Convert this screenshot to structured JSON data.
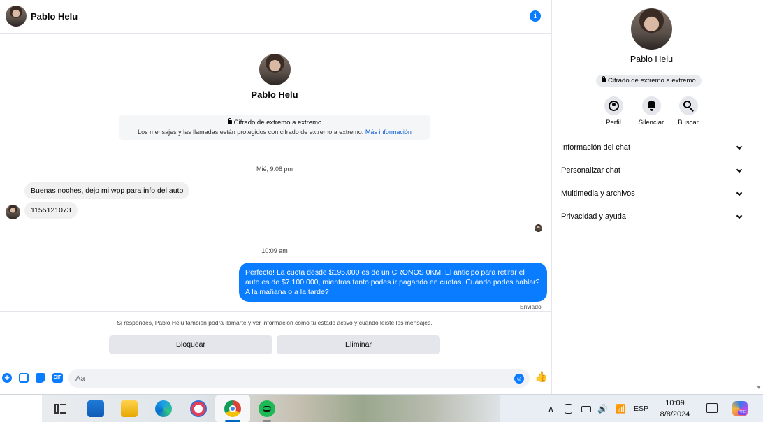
{
  "contact": {
    "name": "Pablo Helu"
  },
  "chat": {
    "encryption_title": "Cifrado de extremo a extremo",
    "encryption_desc": "Los mensajes y las llamadas están protegidos con cifrado de extremo a extremo.",
    "encryption_link": "Más información",
    "timestamps": [
      "Mié, 9:08 pm",
      "10:09 am"
    ],
    "incoming": [
      "Buenas noches, dejo mi wpp para info del auto",
      "1155121073"
    ],
    "outgoing": "Perfecto! La cuota desde $195.000 es de un CRONOS 0KM. El anticipo para retirar el auto es de $7.100.000, mientras tanto podes ir pagando en cuotas. Cuándo podes hablar? A la mañana o a la tarde?",
    "sent_status": "Enviado",
    "notice": "Si respondes, Pablo Helu también podrá llamarte y ver información como tu estado activo y cuándo leíste los mensajes.",
    "block_label": "Bloquear",
    "delete_label": "Eliminar",
    "input_placeholder": "Aa",
    "gif_label": "GIF"
  },
  "panel": {
    "badge": "Cifrado de extremo a extremo",
    "actions": [
      "Perfil",
      "Silenciar",
      "Buscar"
    ],
    "sections": [
      "Información del chat",
      "Personalizar chat",
      "Multimedia y archivos",
      "Privacidad y ayuda"
    ]
  },
  "taskbar": {
    "language": "ESP",
    "time": "10:09",
    "date": "8/8/2024"
  },
  "colors": {
    "accent": "#0a7cff",
    "bubble_in": "#f0f0f0"
  }
}
